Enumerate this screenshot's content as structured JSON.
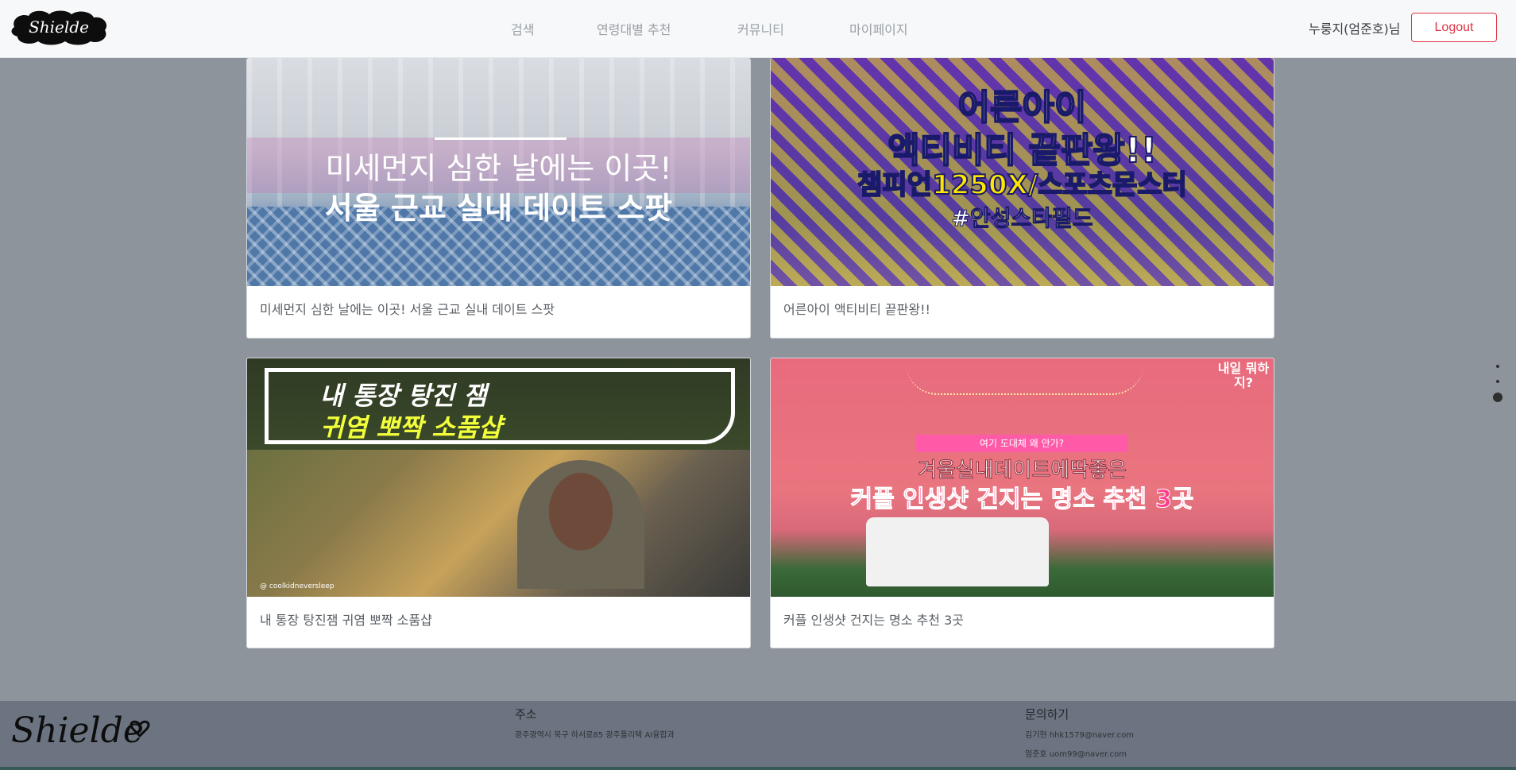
{
  "brand": {
    "logo_text": "Shielde"
  },
  "nav": {
    "items": [
      {
        "label": "검색"
      },
      {
        "label": "연령대별 추천"
      },
      {
        "label": "커뮤니티"
      },
      {
        "label": "마이페이지"
      }
    ]
  },
  "user": {
    "greeting": "누룽지(엄준호)님",
    "logout_label": "Logout"
  },
  "cards": [
    {
      "caption": "미세먼지 심한 날에는 이곳! 서울 근교 실내 데이트 스팟",
      "overlay_line1": "미세먼지 심한 날에는 이곳!",
      "overlay_line2": "서울 근교 실내 데이트 스팟"
    },
    {
      "caption": "어른아이 액티비티 끝판왕!!",
      "overlay_line1": "어른아이",
      "overlay_line2": "액티비티 끝판왕!!",
      "overlay_line3": "챔피언1250X/스포츠몬스터",
      "overlay_line4": "#안성스타필드"
    },
    {
      "caption": "내 통장 탕진잼 귀염 뽀짝 소품샵",
      "overlay_line1": "내 통장 탕진 잼",
      "overlay_line2": "귀염 뽀짝 소품샵",
      "overlay_handle": "@ coolkidneversleep"
    },
    {
      "caption": "커플 인생샷 건지는 명소 추천 3곳",
      "overlay_pill": "여기 도대체 왜 안가?",
      "overlay_line1": "겨울실내데이트에딱좋은",
      "overlay_line2": "커플 인생샷 건지는 명소 추천 3곳",
      "overlay_corner": "내일 뭐하지?"
    }
  ],
  "pagination": {
    "total": 3,
    "active": 3
  },
  "footer": {
    "logo_text": "Shielde",
    "address_title": "주소",
    "address_text": "광주광역시 북구 하서로85 광주폴리텍 AI융합과",
    "contact_title": "문의하기",
    "contacts": [
      "김기현 hhk1579@naver.com",
      "엄준호 uom99@naver.com"
    ]
  },
  "colors": {
    "accent_red": "#dc3545",
    "page_bg": "#8e949c",
    "footer_bg": "#6b7480"
  }
}
